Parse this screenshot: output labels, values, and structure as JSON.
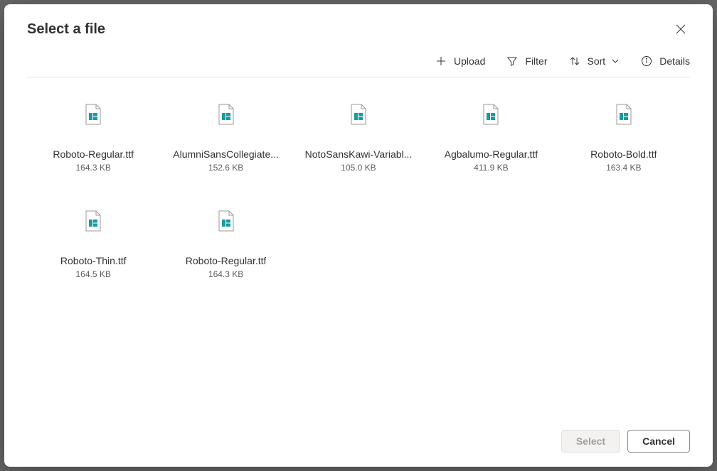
{
  "dialog": {
    "title": "Select a file"
  },
  "toolbar": {
    "upload": "Upload",
    "filter": "Filter",
    "sort": "Sort",
    "details": "Details"
  },
  "files": [
    {
      "name": "Roboto-Regular.ttf",
      "size": "164.3 KB"
    },
    {
      "name": "AlumniSansCollegiate...",
      "size": "152.6 KB"
    },
    {
      "name": "NotoSansKawi-Variabl...",
      "size": "105.0 KB"
    },
    {
      "name": "Agbalumo-Regular.ttf",
      "size": "411.9 KB"
    },
    {
      "name": "Roboto-Bold.ttf",
      "size": "163.4 KB"
    },
    {
      "name": "Roboto-Thin.ttf",
      "size": "164.5 KB"
    },
    {
      "name": "Roboto-Regular.ttf",
      "size": "164.3 KB"
    }
  ],
  "footer": {
    "select": "Select",
    "cancel": "Cancel"
  }
}
